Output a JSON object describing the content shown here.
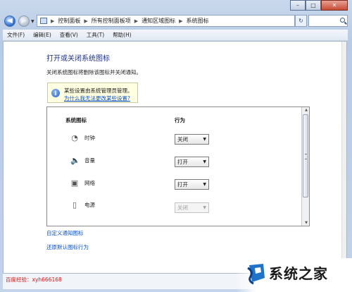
{
  "window": {
    "caption_buttons": [
      "minimize",
      "maximize",
      "close"
    ]
  },
  "address_bar": {
    "crumbs": [
      "控制面板",
      "所有控制面板项",
      "通知区域图标",
      "系统图标"
    ],
    "separator": "▶"
  },
  "menu": [
    "文件(F)",
    "编辑(E)",
    "查看(V)",
    "工具(T)",
    "帮助(H)"
  ],
  "page": {
    "title": "打开或关闭系统图标",
    "description": "关闭系统图标将删除该图标并关闭通知。",
    "info_text": "某些设置由系统管理员管理。",
    "info_link": "为什么我无法更改某些设置?",
    "col_icons": "系统图标",
    "col_behavior": "行为",
    "rows": [
      {
        "label": "时钟",
        "value": "关闭",
        "enabled": true,
        "icon": "clock-icon"
      },
      {
        "label": "音量",
        "value": "打开",
        "enabled": true,
        "icon": "speaker-icon"
      },
      {
        "label": "网络",
        "value": "打开",
        "enabled": true,
        "icon": "network-icon"
      },
      {
        "label": "电源",
        "value": "关闭",
        "enabled": false,
        "icon": "power-icon"
      }
    ],
    "link_customize": "自定义通知图标",
    "link_restore": "还原默认图标行为"
  },
  "watermark": "百度经验：xyh666168",
  "logo": {
    "text": "系统之家"
  },
  "colors": {
    "link": "#0a50c8",
    "title": "#1e3287",
    "watermark": "#d01818"
  }
}
